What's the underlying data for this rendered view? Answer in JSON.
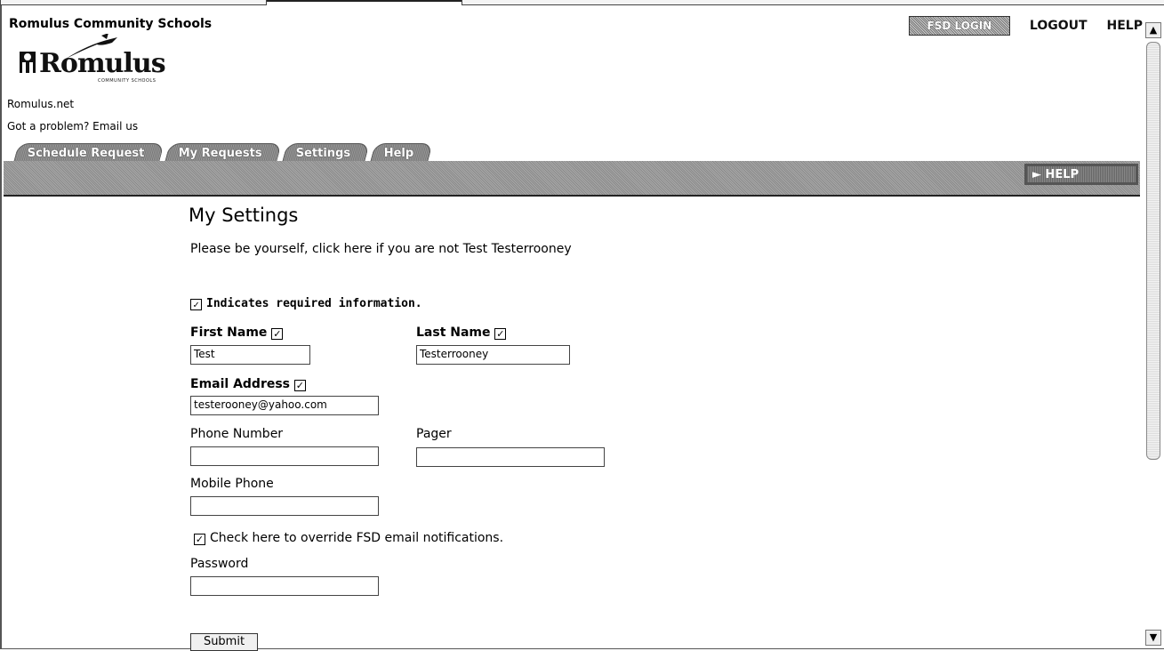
{
  "header": {
    "school_name": "Romulus Community Schools",
    "logo_text": "Romulus",
    "logo_subtext": "COMMUNITY SCHOOLS",
    "site_link": "Romulus.net",
    "problem_link": "Got a problem? Email us",
    "fsd_badge": "FSD LOGIN",
    "logout": "LOGOUT",
    "help": "HELP"
  },
  "tabs": [
    {
      "label": "Schedule Request"
    },
    {
      "label": "My Requests"
    },
    {
      "label": "Settings"
    },
    {
      "label": "Help"
    }
  ],
  "help_button": "► HELP",
  "main": {
    "heading": "My Settings",
    "intro": "Please be yourself, click here if you are not Test Testerrooney",
    "required_note": "Indicates required information.",
    "first_name_label": "First Name",
    "first_name_value": "Test",
    "last_name_label": "Last Name",
    "last_name_value": "Testerrooney",
    "email_label": "Email Address",
    "email_value": "testerooney@yahoo.com",
    "phone_label": "Phone Number",
    "phone_value": "",
    "pager_label": "Pager",
    "pager_value": "",
    "mobile_label": "Mobile Phone",
    "mobile_value": "",
    "override_label": "Check here to override FSD email notifications.",
    "override_checked": true,
    "password_label": "Password",
    "password_value": "",
    "submit_label": "Submit"
  },
  "scrollbar": {
    "up_icon": "chevron-up-icon",
    "down_icon": "chevron-down-icon"
  }
}
